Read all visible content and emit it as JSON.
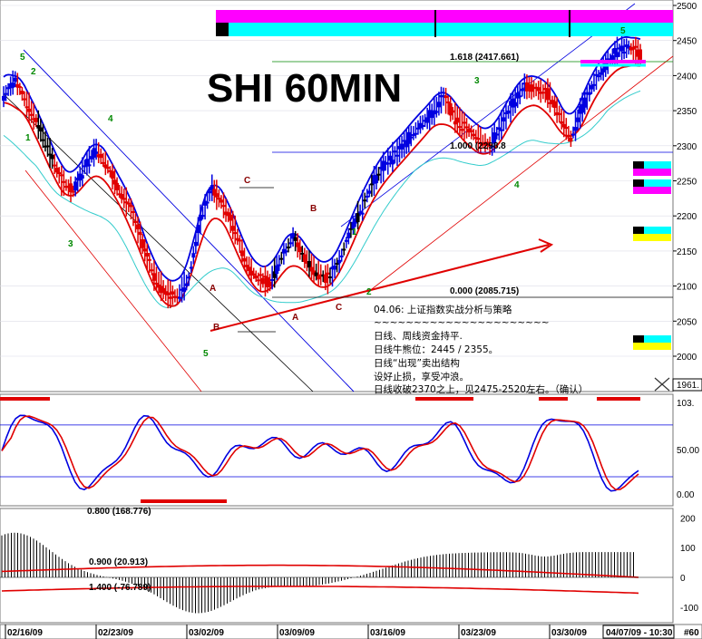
{
  "title": "SHI 60MIN",
  "colors": {
    "bar_red": "#e00000",
    "bar_blue": "#0000e0",
    "bar_black": "#000000",
    "band_red": "#e00000",
    "band_blue": "#0000e0",
    "band_cyan": "#33cccc",
    "magenta": "#ff00ff",
    "cyan": "#00ffff",
    "yellow": "#ffff00",
    "wave_green": "#008800",
    "wave_red": "#880000",
    "grid": "#9999bb"
  },
  "price_axis": {
    "ticks": [
      "2500",
      "2450",
      "2400",
      "2350",
      "2300",
      "2250",
      "2200",
      "2150",
      "2100",
      "2050",
      "2000"
    ],
    "last_label": "1961.",
    "ylim": [
      1960,
      2505
    ]
  },
  "stoch_axis": {
    "ticks": [
      "103.",
      "50.00",
      "0.00"
    ]
  },
  "macd_axis": {
    "ticks": [
      "200",
      "100",
      "0",
      "-100"
    ]
  },
  "dates": [
    "02/16/09",
    "02/23/09",
    "03/02/09",
    "03/09/09",
    "03/16/09",
    "03/23/09",
    "03/30/09"
  ],
  "date_current": "04/07/09 - 10:30",
  "date_edge": "#60",
  "fib_labels": {
    "f1618": "1.618 (2417.661)",
    "f1000": "1.000 (2298.8",
    "f0000": "0.000 (2085.715)"
  },
  "macd_labels": {
    "a": "0.800 (168.776)",
    "b": "0.900 (20.913)",
    "c": "1.400 (-76.789)"
  },
  "wave_labels": {
    "w5a": "5",
    "w2": "2",
    "w1": "1",
    "w4": "4",
    "w3": "3",
    "wA": "A",
    "wB": "B",
    "w5b": "5",
    "wC1": "C",
    "wB2": "B",
    "wA2": "A",
    "wC2": "C",
    "wi": "1",
    "wii": "2",
    "w3b": "3",
    "w4b": "4",
    "w5c": "5"
  },
  "annotation": {
    "heading": "04.06: 上证指数实战分析与策略",
    "divider": "~~~~~~~~~~~~~~~~~~~~~~",
    "l1": "日线、周线资金持平.",
    "l2": "日线牛熊位：2445 / 2355。",
    "l3": "日线“出现”卖出结构",
    "l4": "设好止损，享受冲浪。",
    "l5": "日线收破2370之上，见2475-2520左右。（确认）"
  },
  "close_icon": "close-icon",
  "chart_data": {
    "type": "candlestick",
    "title": "SHI 60MIN",
    "x": [
      "02/16/09",
      "02/23/09",
      "03/02/09",
      "03/09/09",
      "03/16/09",
      "03/23/09",
      "03/30/09",
      "04/07/09 - 10:30"
    ],
    "close_path": [
      2370,
      2395,
      2360,
      2330,
      2290,
      2250,
      2235,
      2270,
      2295,
      2270,
      2235,
      2210,
      2160,
      2115,
      2090,
      2085,
      2110,
      2195,
      2240,
      2215,
      2180,
      2130,
      2110,
      2105,
      2140,
      2170,
      2140,
      2120,
      2110,
      2135,
      2180,
      2215,
      2250,
      2275,
      2290,
      2310,
      2330,
      2345,
      2370,
      2340,
      2325,
      2310,
      2300,
      2330,
      2360,
      2385,
      2380,
      2375,
      2345,
      2310,
      2355,
      2390,
      2415,
      2435,
      2440,
      2430
    ],
    "indicators": [
      "bollinger/envelope bands (blue, red, cyan)",
      "stochastic %K/%D (0-103)",
      "MACD histogram (-100..200)"
    ],
    "fibonacci": {
      "1.618": 2417.661,
      "1.000": 2298.8,
      "0.000": 2085.715
    },
    "ylim": [
      1961,
      2500
    ]
  }
}
